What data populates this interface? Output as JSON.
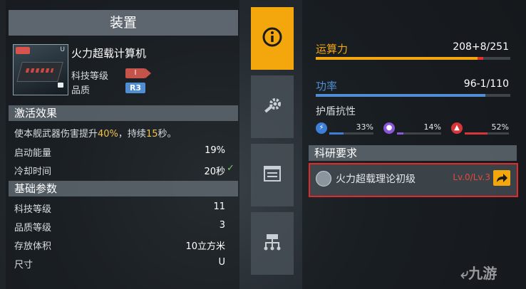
{
  "left_panel": {
    "title": "装置",
    "item": {
      "name": "火力超载计算机",
      "icon": "fire-control-computer-icon",
      "tag_text": "I",
      "size_mark": "U",
      "tech_level_label": "科技等级",
      "tech_badge": "I",
      "quality_label": "品质",
      "quality_badge": "R3"
    },
    "activation": {
      "header": "激活效果",
      "desc_prefix": "使本舰武器伤害提升",
      "desc_pct": "40%",
      "desc_mid": "，持续",
      "desc_sec": "15",
      "desc_suffix": "秒。",
      "startup_energy_label": "启动能量",
      "startup_energy_value": "19%",
      "cooldown_label": "冷却时间",
      "cooldown_value": "20秒"
    },
    "basic": {
      "header": "基础参数",
      "rows": [
        {
          "label": "科技等级",
          "value": "11"
        },
        {
          "label": "品质等级",
          "value": "3"
        },
        {
          "label": "存放体积",
          "value": "10立方米"
        },
        {
          "label": "尺寸",
          "value": "U"
        }
      ]
    }
  },
  "tabs": [
    {
      "icon": "info-icon",
      "active": true
    },
    {
      "icon": "wrench-gear-icon",
      "active": false
    },
    {
      "icon": "list-icon",
      "active": false
    },
    {
      "icon": "module-tree-icon",
      "active": false
    }
  ],
  "right_panel": {
    "compute": {
      "label": "运算力",
      "value": "208+8/251",
      "fill": 0.83,
      "extra_fill": 0.03,
      "color": "#f4a70d",
      "extra_color": "#e0342e"
    },
    "power": {
      "label": "功率",
      "value": "96-1/110",
      "fill": 0.87,
      "color": "#4f8ed3"
    },
    "shield": {
      "label": "护盾抗性",
      "items": [
        {
          "icon": "lightning-icon",
          "value": "33%",
          "fill": 0.33,
          "color": "#3d7fd6"
        },
        {
          "icon": "energy-orb-icon",
          "value": "14%",
          "fill": 0.14,
          "color": "#8b57d9"
        },
        {
          "icon": "flame-icon",
          "value": "52%",
          "fill": 0.52,
          "color": "#d9343a"
        }
      ]
    },
    "research": {
      "header": "科研要求",
      "name": "火力超载理论初级",
      "level": "Lv.0/Lv.3",
      "level_color": "#e04a3f"
    }
  },
  "watermark": "九游"
}
